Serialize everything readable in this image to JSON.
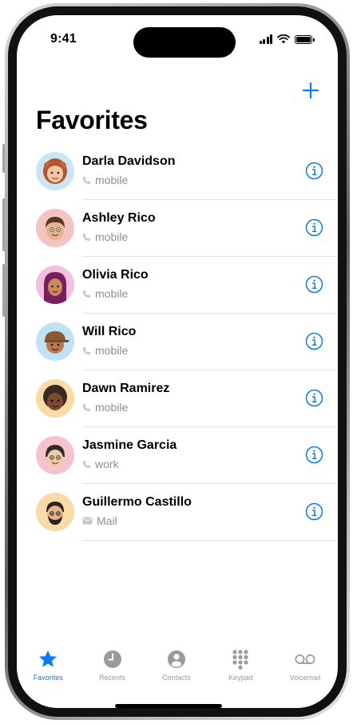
{
  "status_bar": {
    "time": "9:41"
  },
  "header": {
    "title": "Favorites",
    "add_icon": "plus-icon"
  },
  "colors": {
    "accent": "#0a7aff",
    "secondary_text": "#8e8e93",
    "tab_inactive": "#9a9aa0"
  },
  "favorites": [
    {
      "name": "Darla Davidson",
      "type": "mobile",
      "type_icon": "phone-icon",
      "avatar_bg": "#c8e6f5"
    },
    {
      "name": "Ashley Rico",
      "type": "mobile",
      "type_icon": "phone-icon",
      "avatar_bg": "#f6c3c3"
    },
    {
      "name": "Olivia Rico",
      "type": "mobile",
      "type_icon": "phone-icon",
      "avatar_bg": "#f5c0dd"
    },
    {
      "name": "Will Rico",
      "type": "mobile",
      "type_icon": "phone-icon",
      "avatar_bg": "#bfe3f5"
    },
    {
      "name": "Dawn Ramirez",
      "type": "mobile",
      "type_icon": "phone-icon",
      "avatar_bg": "#f8dba5"
    },
    {
      "name": "Jasmine Garcia",
      "type": "work",
      "type_icon": "phone-icon",
      "avatar_bg": "#f6c3cb"
    },
    {
      "name": "Guillermo Castillo",
      "type": "Mail",
      "type_icon": "mail-icon",
      "avatar_bg": "#f8dba5"
    }
  ],
  "tabs": [
    {
      "label": "Favorites",
      "icon": "star-icon",
      "active": true
    },
    {
      "label": "Recents",
      "icon": "clock-icon",
      "active": false
    },
    {
      "label": "Contacts",
      "icon": "person-icon",
      "active": false
    },
    {
      "label": "Keypad",
      "icon": "keypad-icon",
      "active": false
    },
    {
      "label": "Voicemail",
      "icon": "voicemail-icon",
      "active": false
    }
  ]
}
